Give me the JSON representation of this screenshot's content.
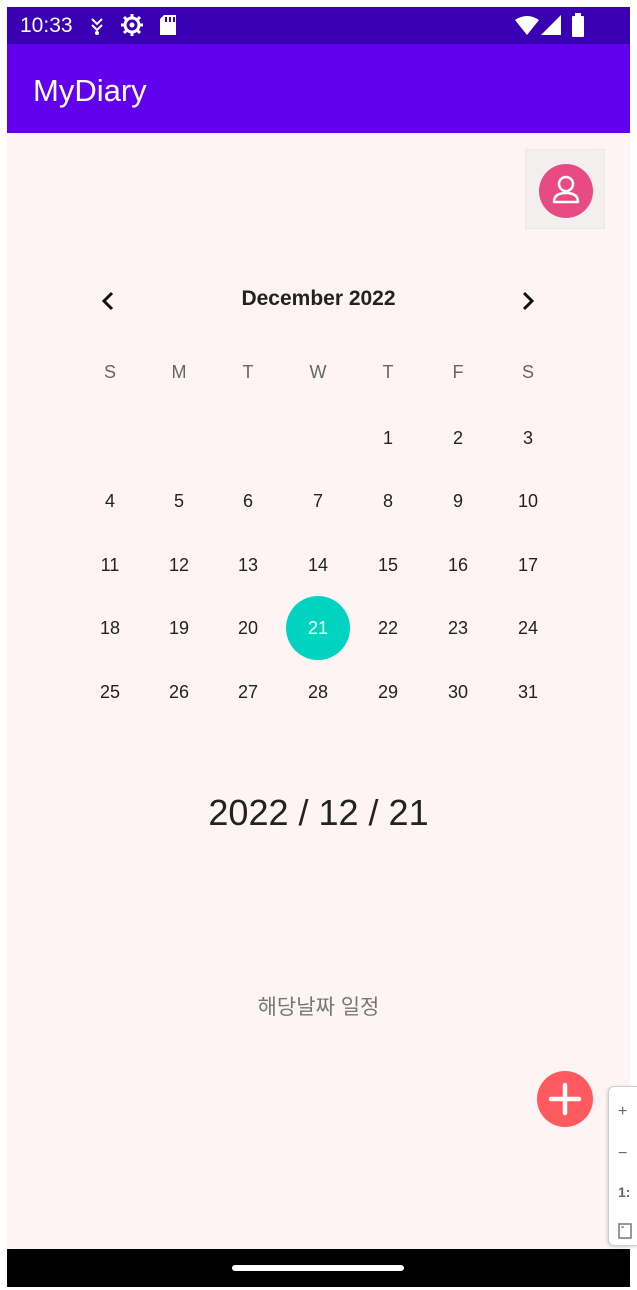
{
  "status_bar": {
    "time": "10:33"
  },
  "app_bar": {
    "title": "MyDiary"
  },
  "calendar": {
    "month_label": "December 2022",
    "weekdays": [
      "S",
      "M",
      "T",
      "W",
      "T",
      "F",
      "S"
    ],
    "weeks": [
      [
        "",
        "",
        "",
        "",
        "1",
        "2",
        "3"
      ],
      [
        "4",
        "5",
        "6",
        "7",
        "8",
        "9",
        "10"
      ],
      [
        "11",
        "12",
        "13",
        "14",
        "15",
        "16",
        "17"
      ],
      [
        "18",
        "19",
        "20",
        "21",
        "22",
        "23",
        "24"
      ],
      [
        "25",
        "26",
        "27",
        "28",
        "29",
        "30",
        "31"
      ]
    ],
    "selected_day": "21",
    "selected_color": "#00d4c0"
  },
  "selected_date_text": "2022 / 12 / 21",
  "schedule_label": "해당날짜 일정",
  "fab": {
    "icon": "plus-icon",
    "color": "#ff5a5f"
  },
  "profile_button": {
    "icon": "person-icon",
    "color": "#e84a82"
  },
  "side_panel": {
    "zoom_in": "+",
    "zoom_out": "−",
    "ratio": "1:"
  }
}
